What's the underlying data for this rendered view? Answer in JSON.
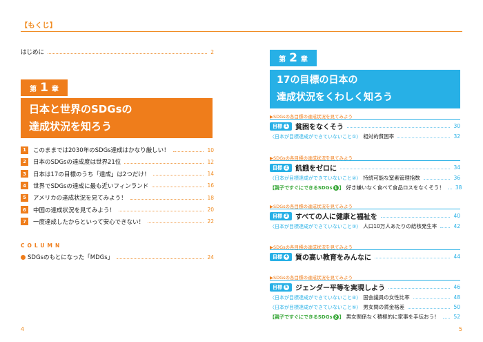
{
  "header": {
    "title": "【もくじ】"
  },
  "left": {
    "intro": {
      "label": "はじめに",
      "page": "2"
    },
    "chapter1": {
      "prefix": "第",
      "num": "1",
      "suffix": "章",
      "title_line1": "日本と世界のSDGsの",
      "title_line2": "達成状況を知ろう",
      "items": [
        {
          "num": "1",
          "text": "このままでは2030年のSDGs達成はかなり厳しい！",
          "page": "10"
        },
        {
          "num": "2",
          "text": "日本のSDGsの達成度は世界21位",
          "page": "12"
        },
        {
          "num": "3",
          "text": "日本は17の目標のうち「達成」は2つだけ！",
          "page": "14"
        },
        {
          "num": "4",
          "text": "世界でSDGsの達成に最も近いフィンランド",
          "page": "16"
        },
        {
          "num": "5",
          "text": "アメリカの達成状況を見てみよう！",
          "page": "18"
        },
        {
          "num": "6",
          "text": "中国の達成状況を見てみよう！",
          "page": "20"
        },
        {
          "num": "7",
          "text": "一度達成したからといって安心できない！",
          "page": "22"
        }
      ]
    },
    "column": {
      "label": "COLUMN",
      "item": {
        "text": "SDGsのもとになった「MDGs」",
        "page": "24"
      }
    },
    "page_number": "4"
  },
  "right": {
    "chapter2": {
      "prefix": "第",
      "num": "2",
      "suffix": "章",
      "title_line1": "17の目標の日本の",
      "title_line2": "達成状況をくわしく知ろう"
    },
    "sections": [
      {
        "label": "▶SDGsの各目標の達成状況を見てみよう",
        "goal": {
          "badge": "目標",
          "num": "1",
          "title": "貧困をなくそう",
          "page": "30"
        },
        "subs": [
          {
            "kind": "blue",
            "tag": "〈日本が目標達成ができていないこと①〉",
            "text": "相対的貧困率",
            "page": "32"
          }
        ]
      },
      {
        "label": "▶SDGsの各目標の達成状況を見てみよう",
        "goal": {
          "badge": "目標",
          "num": "2",
          "title": "飢餓をゼロに",
          "page": "34"
        },
        "subs": [
          {
            "kind": "blue",
            "tag": "〈日本が目標達成ができていないこと②〉",
            "text": "持続可能な窒素管理指数",
            "page": "36"
          },
          {
            "kind": "green",
            "tag": "【親子ですぐにできるSDGs",
            "num": "1",
            "tag_end": "】",
            "text": "好き嫌いなく食べて食品ロスをなくそう！",
            "page": "38"
          }
        ]
      },
      {
        "label": "▶SDGsの各目標の達成状況を見てみよう",
        "goal": {
          "badge": "目標",
          "num": "3",
          "title": "すべての人に健康と福祉を",
          "page": "40"
        },
        "subs": [
          {
            "kind": "blue",
            "tag": "〈日本が目標達成ができていないこと③〉",
            "text": "人口10万人あたりの結核発生率",
            "page": "42"
          }
        ]
      },
      {
        "label": "▶SDGsの各目標の達成状況を見てみよう",
        "goal": {
          "badge": "目標",
          "num": "4",
          "title": "質の高い教育をみんなに",
          "page": "44"
        },
        "subs": []
      },
      {
        "label": "▶SDGsの各目標の達成状況を見てみよう",
        "goal": {
          "badge": "目標",
          "num": "5",
          "title": "ジェンダー平等を実現しよう",
          "page": "46"
        },
        "subs": [
          {
            "kind": "blue",
            "tag": "〈日本が目標達成ができていないこと④〉",
            "text": "国会議員の女性比率",
            "page": "48"
          },
          {
            "kind": "blue",
            "tag": "〈日本が目標達成ができていないこと⑤〉",
            "text": "男女間の賃金格差",
            "page": "50"
          },
          {
            "kind": "green",
            "tag": "【親子ですぐにできるSDGs",
            "num": "2",
            "tag_end": "】",
            "text": "男女関係なく積極的に家事を手伝おう！",
            "page": "52"
          }
        ]
      }
    ],
    "page_number": "5"
  }
}
